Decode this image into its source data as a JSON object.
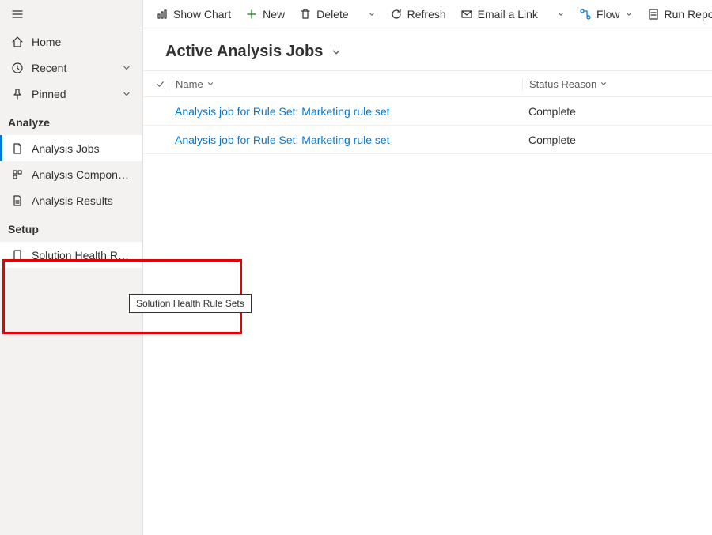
{
  "sidebar": {
    "home": "Home",
    "recent": "Recent",
    "pinned": "Pinned",
    "section_analyze": "Analyze",
    "analysis_jobs": "Analysis Jobs",
    "analysis_components": "Analysis Components",
    "analysis_results": "Analysis Results",
    "section_setup": "Setup",
    "solution_health_rule": "Solution Health Rule ..."
  },
  "tooltip": "Solution Health Rule Sets",
  "commands": {
    "show_chart": "Show Chart",
    "new": "New",
    "delete": "Delete",
    "refresh": "Refresh",
    "email_link": "Email a Link",
    "flow": "Flow",
    "run_report": "Run Report"
  },
  "page_title": "Active Analysis Jobs",
  "grid": {
    "columns": {
      "name": "Name",
      "status": "Status Reason"
    },
    "rows": [
      {
        "name": "Analysis job for Rule Set: Marketing rule set",
        "status": "Complete"
      },
      {
        "name": "Analysis job for Rule Set: Marketing rule set",
        "status": "Complete"
      }
    ]
  }
}
